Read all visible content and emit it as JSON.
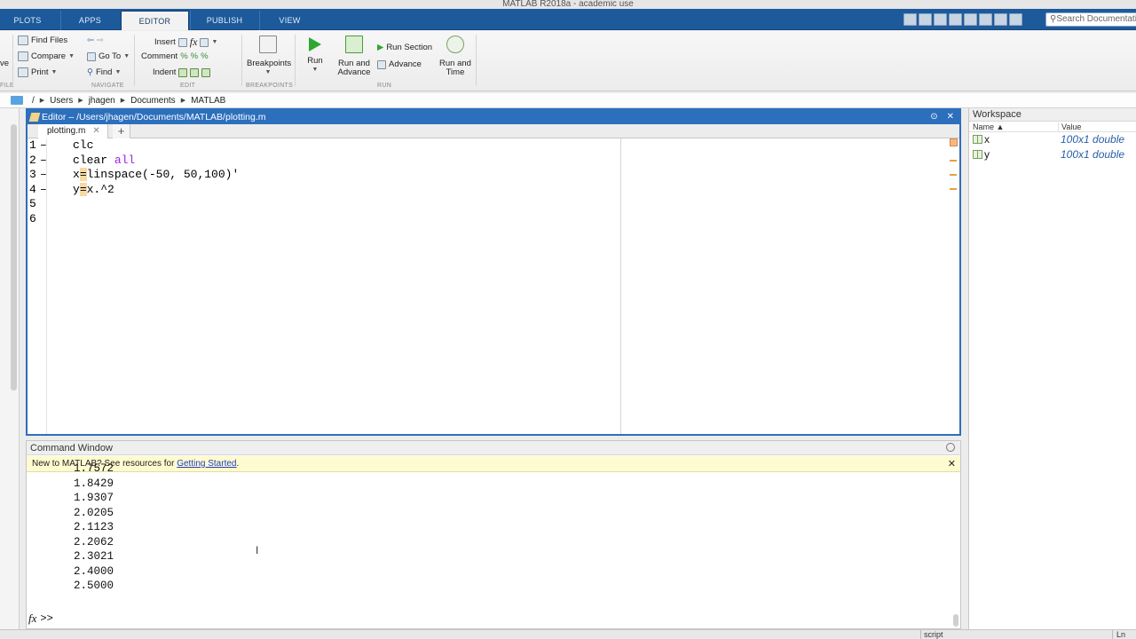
{
  "window": {
    "title": "MATLAB R2018a - academic use"
  },
  "tabs": [
    {
      "label": "PLOTS",
      "active": false
    },
    {
      "label": "APPS",
      "active": false
    },
    {
      "label": "EDITOR",
      "active": true
    },
    {
      "label": "PUBLISH",
      "active": false
    },
    {
      "label": "VIEW",
      "active": false
    }
  ],
  "search": {
    "placeholder": "Search Documentation"
  },
  "ribbon": {
    "file": {
      "save_label": "ve",
      "label": "FILE"
    },
    "navigate": {
      "find_files": "Find Files",
      "compare": "Compare",
      "print": "Print",
      "goto": "Go To",
      "find": "Find",
      "label": "NAVIGATE"
    },
    "edit": {
      "insert": "Insert",
      "comment": "Comment",
      "indent": "Indent",
      "fx": "fx",
      "label": "EDIT"
    },
    "breakpoints": {
      "button": "Breakpoints",
      "label": "BREAKPOINTS"
    },
    "run": {
      "run": "Run",
      "run_advance_l1": "Run and",
      "run_advance_l2": "Advance",
      "run_section": "Run Section",
      "advance": "Advance",
      "run_time_l1": "Run and",
      "run_time_l2": "Time",
      "label": "RUN"
    }
  },
  "address": {
    "root": "/",
    "crumbs": [
      "Users",
      "jhagen",
      "Documents",
      "MATLAB"
    ]
  },
  "editor": {
    "title": "Editor – /Users/jhagen/Documents/MATLAB/plotting.m",
    "tab": "plotting.m",
    "lines": [
      {
        "num": "1",
        "dash": "–",
        "code": "clc"
      },
      {
        "num": "2",
        "dash": "–",
        "code": "clear ",
        "kw": "all"
      },
      {
        "num": "3",
        "dash": "–",
        "pre": "x",
        "hl": "=",
        "post": "linspace(-50, 50,100)'"
      },
      {
        "num": "4",
        "dash": "–",
        "pre": "y",
        "hl": "=",
        "post": "x.^2"
      },
      {
        "num": "5",
        "dash": "",
        "code": ""
      },
      {
        "num": "6",
        "dash": "",
        "code": ""
      }
    ]
  },
  "command": {
    "title": "Command Window",
    "notice_text": "New to MATLAB? See resources for ",
    "notice_link": "Getting Started",
    "notice_end": ".",
    "output": [
      "1.7572",
      "1.8429",
      "1.9307",
      "2.0205",
      "2.1123",
      "2.2062",
      "2.3021",
      "2.4000",
      "2.5000"
    ],
    "prompt": ">>",
    "fx": "fx"
  },
  "workspace": {
    "title": "Workspace",
    "col_name": "Name ▲",
    "col_value": "Value",
    "vars": [
      {
        "name": "x",
        "value": "100x1 double"
      },
      {
        "name": "y",
        "value": "100x1 double"
      }
    ]
  },
  "status": {
    "mode": "script",
    "pos": "Ln"
  },
  "colors": {
    "accent": "#2c6fbd",
    "tabbar": "#1d5a9c",
    "keyword": "#a020f0",
    "notice": "#fffbd0"
  }
}
